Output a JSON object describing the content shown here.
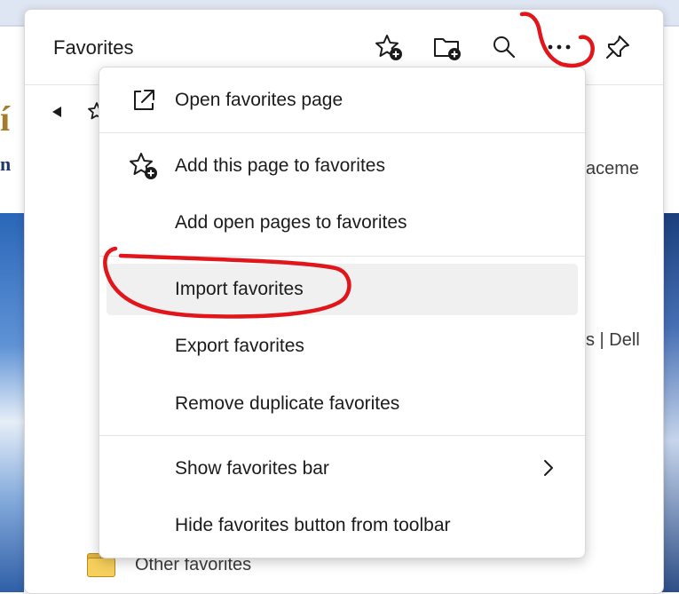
{
  "panel": {
    "title": "Favorites",
    "background_fragments": {
      "right_top": "aceme",
      "right_mid": "s | Dell"
    },
    "other_favorites_label": "Other favorites"
  },
  "menu": {
    "items": [
      {
        "label": "Open favorites page",
        "icon": "external-link-icon"
      },
      {
        "label": "Add this page to favorites",
        "icon": "star-add-icon"
      },
      {
        "label": "Add open pages to favorites",
        "icon": ""
      },
      {
        "label": "Import favorites",
        "icon": "",
        "highlighted": true
      },
      {
        "label": "Export favorites",
        "icon": ""
      },
      {
        "label": "Remove duplicate favorites",
        "icon": ""
      },
      {
        "label": "Show favorites bar",
        "icon": "chevron-right-icon"
      },
      {
        "label": "Hide favorites button from toolbar",
        "icon": ""
      }
    ]
  },
  "colors": {
    "annotation": "#e0161b",
    "hover": "#f0f0f0",
    "text": "#1b1b1b",
    "folder": "#f6cf5c"
  }
}
